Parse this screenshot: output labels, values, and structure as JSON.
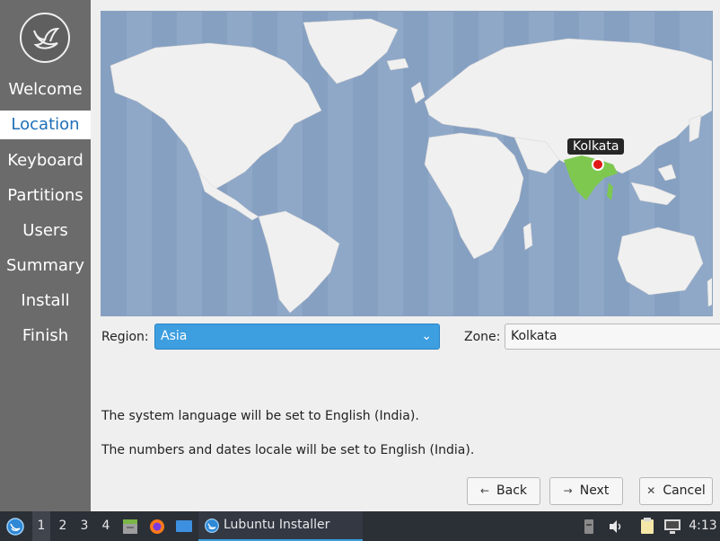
{
  "sidebar": {
    "steps": [
      {
        "label": "Welcome",
        "active": false
      },
      {
        "label": "Location",
        "active": true
      },
      {
        "label": "Keyboard",
        "active": false
      },
      {
        "label": "Partitions",
        "active": false
      },
      {
        "label": "Users",
        "active": false
      },
      {
        "label": "Summary",
        "active": false
      },
      {
        "label": "Install",
        "active": false
      },
      {
        "label": "Finish",
        "active": false
      }
    ]
  },
  "map": {
    "selected_city": "Kolkata",
    "ocean_color": "#8fa8c8",
    "land_color": "#f0f0f0",
    "highlight_color": "#7ec850",
    "pin_color": "#e01818"
  },
  "location": {
    "region_label": "Region:",
    "region_value": "Asia",
    "zone_label": "Zone:",
    "zone_value": "Kolkata"
  },
  "messages": {
    "language": "The system language will be set to English (India).",
    "locale": "The numbers and dates locale will be set to English (India)."
  },
  "buttons": {
    "back": "Back",
    "next": "Next",
    "cancel": "Cancel"
  },
  "taskbar": {
    "workspaces": [
      "1",
      "2",
      "3",
      "4"
    ],
    "active_workspace": "1",
    "task_label": "Lubuntu Installer",
    "clock": "4:13"
  },
  "colors": {
    "accent": "#3d9ee0",
    "sidebar_bg": "#6b6b6b",
    "taskbar_bg": "#2b2f36"
  }
}
